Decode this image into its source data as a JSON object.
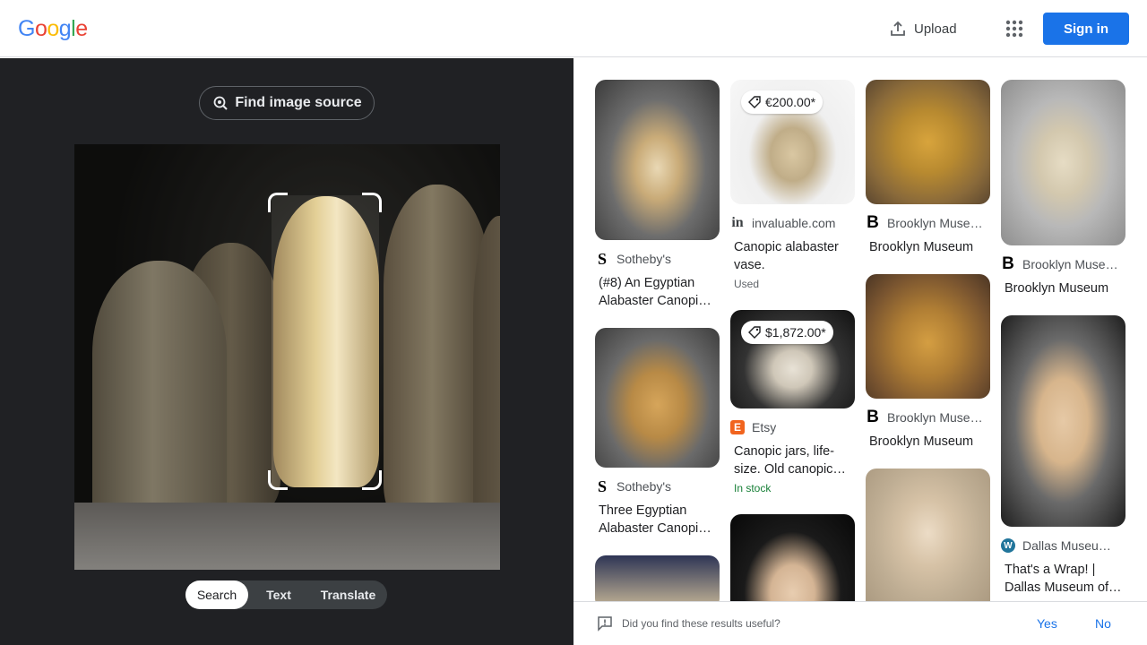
{
  "header": {
    "logo_letters": [
      "G",
      "o",
      "o",
      "g",
      "l",
      "e"
    ],
    "logo_colors": [
      "#4285f4",
      "#ea4335",
      "#fbbc05",
      "#4285f4",
      "#34a853",
      "#ea4335"
    ],
    "upload_label": "Upload",
    "apps_icon": "apps-grid-icon",
    "signin_label": "Sign in"
  },
  "lens": {
    "find_source_label": "Find image source",
    "modes": [
      "Search",
      "Text",
      "Translate"
    ],
    "active_mode": "Search"
  },
  "results": [
    {
      "source": "Sotheby's",
      "favicon": "S",
      "title": "(#8) An Egyptian Alabaster Canopi…"
    },
    {
      "source": "Sotheby's",
      "favicon": "S",
      "title": "Three Egyptian Alabaster Canopi…"
    },
    {
      "source": "invaluable.com",
      "favicon": "in",
      "title": "Canopic alabaster vase.",
      "price": "€200.00*",
      "note": "Used"
    },
    {
      "source": "Etsy",
      "favicon": "E",
      "title": "Canopic jars, life-size. Old canopic…",
      "price": "$1,872.00*",
      "note": "In stock"
    },
    {
      "source": "Brooklyn Muse…",
      "favicon": "B",
      "title": "Brooklyn Museum"
    },
    {
      "source": "Brooklyn Muse…",
      "favicon": "B",
      "title": "Brooklyn Museum"
    },
    {
      "source": "Brooklyn Muse…",
      "favicon": "B",
      "title": "Brooklyn Museum"
    },
    {
      "source": "Dallas Museu…",
      "favicon": "W",
      "title": "That's a Wrap! | Dallas Museum of…"
    }
  ],
  "feedback": {
    "question": "Did you find these results useful?",
    "yes": "Yes",
    "no": "No"
  },
  "colors": {
    "accent": "#1a73e8",
    "dark_panel": "#202124",
    "in_stock": "#188038",
    "etsy": "#f1641e",
    "wordpress": "#21759b"
  }
}
